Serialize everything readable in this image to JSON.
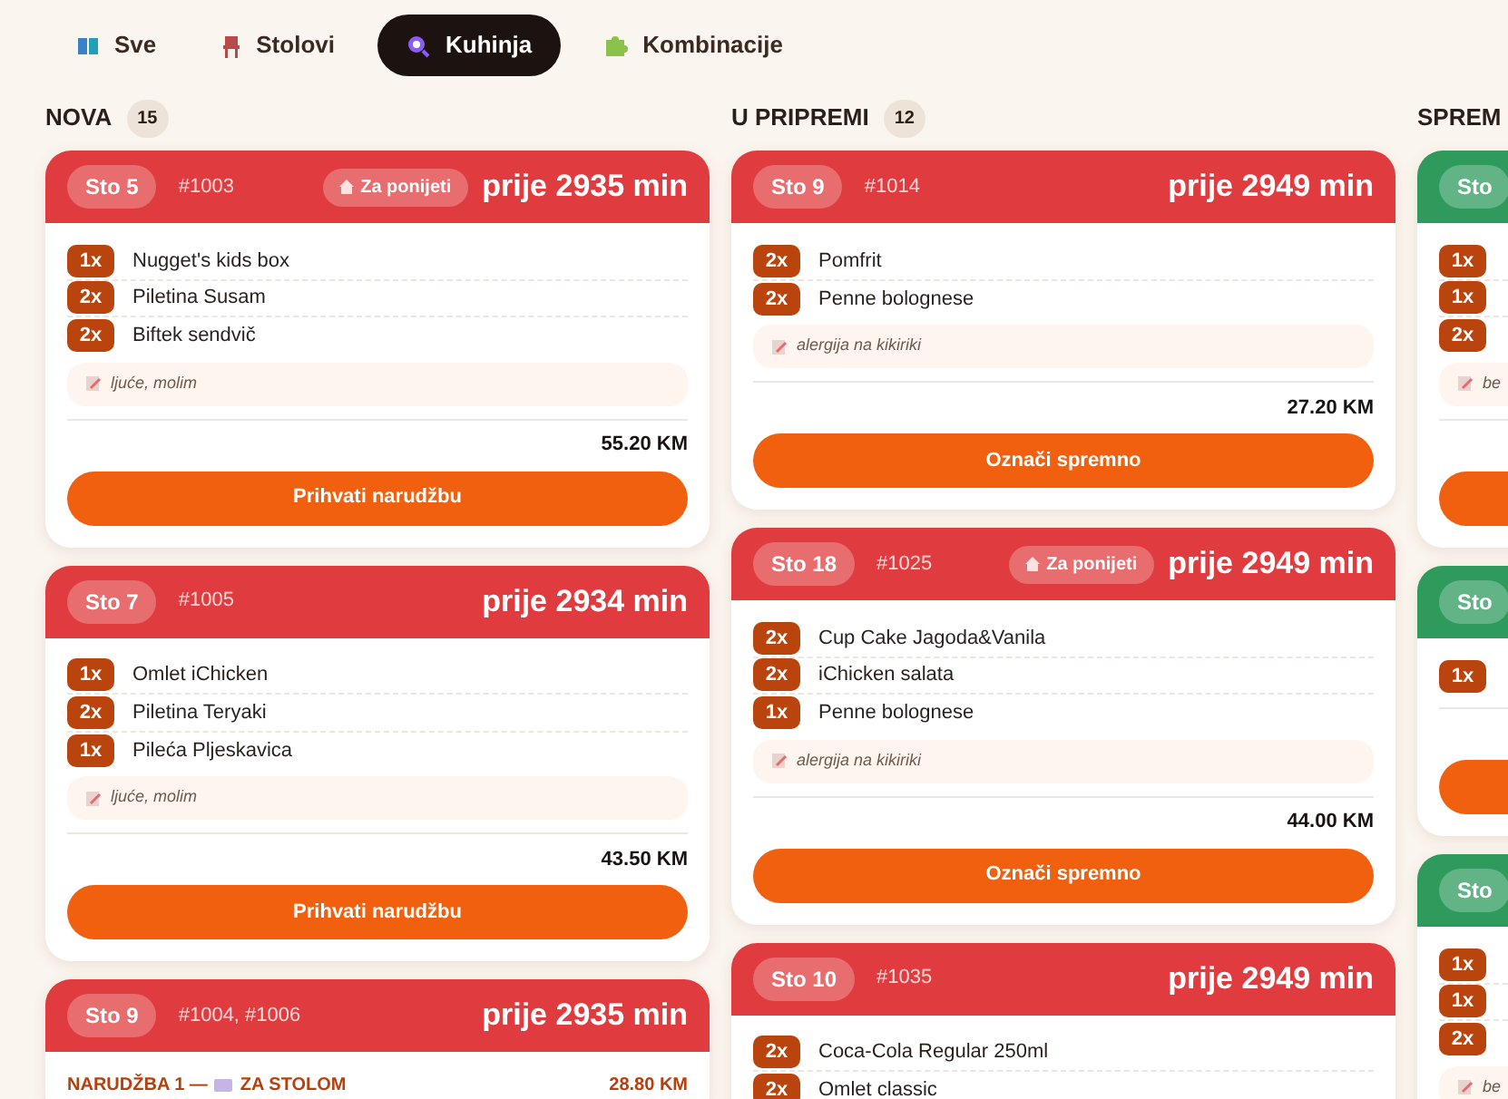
{
  "tabs": [
    {
      "label": "Sve",
      "selected": false
    },
    {
      "label": "Stolovi",
      "selected": false
    },
    {
      "label": "Kuhinja",
      "selected": true
    },
    {
      "label": "Kombinacije",
      "selected": false
    }
  ],
  "columns": [
    {
      "title": "NOVA",
      "count": "15",
      "kind": "new",
      "tickets": [
        {
          "table": "Sto 5",
          "ids": "#1003",
          "takeaway": "Za ponijeti",
          "time": "prije 2935 min",
          "items": [
            {
              "qty": "1x",
              "name": "Nugget's kids box"
            },
            {
              "qty": "2x",
              "name": "Piletina Susam"
            },
            {
              "qty": "2x",
              "name": "Biftek sendvič"
            }
          ],
          "note": "ljuće, molim",
          "total": "55.20 KM",
          "button": "Prihvati narudžbu"
        },
        {
          "table": "Sto 7",
          "ids": "#1005",
          "time": "prije 2934 min",
          "items": [
            {
              "qty": "1x",
              "name": "Omlet iChicken"
            },
            {
              "qty": "2x",
              "name": "Piletina Teryaki"
            },
            {
              "qty": "1x",
              "name": "Pileća Pljeskavica"
            }
          ],
          "note": "ljuće, molim",
          "total": "43.50 KM",
          "button": "Prihvati narudžbu"
        },
        {
          "table": "Sto 9",
          "ids": "#1004, #1006",
          "time": "prije 2935 min",
          "orders": [
            {
              "label": "NARUDŽBA 1 —",
              "type": "ZA STOLOM",
              "total": "28.80 KM"
            }
          ]
        }
      ]
    },
    {
      "title": "U PRIPREMI",
      "count": "12",
      "kind": "preparing",
      "tickets": [
        {
          "table": "Sto 9",
          "ids": "#1014",
          "time": "prije 2949 min",
          "items": [
            {
              "qty": "2x",
              "name": "Pomfrit"
            },
            {
              "qty": "2x",
              "name": "Penne bolognese"
            }
          ],
          "note": "alergija na kikiriki",
          "total": "27.20 KM",
          "button": "Označi spremno"
        },
        {
          "table": "Sto 18",
          "ids": "#1025",
          "takeaway": "Za ponijeti",
          "time": "prije 2949 min",
          "items": [
            {
              "qty": "2x",
              "name": "Cup Cake Jagoda&Vanila"
            },
            {
              "qty": "2x",
              "name": "iChicken salata"
            },
            {
              "qty": "1x",
              "name": "Penne bolognese"
            }
          ],
          "note": "alergija na kikiriki",
          "total": "44.00 KM",
          "button": "Označi spremno"
        },
        {
          "table": "Sto 10",
          "ids": "#1035",
          "time": "prije 2949 min",
          "items": [
            {
              "qty": "2x",
              "name": "Coca-Cola Regular 250ml"
            },
            {
              "qty": "2x",
              "name": "Omlet classic"
            }
          ]
        }
      ]
    },
    {
      "title": "SPREM",
      "kind": "ready",
      "tickets": [
        {
          "table": "Sto",
          "items": [
            {
              "qty": "1x"
            },
            {
              "qty": "1x"
            },
            {
              "qty": "2x"
            }
          ],
          "note": "be",
          "button_shown": true
        },
        {
          "table": "Sto",
          "items": [
            {
              "qty": "1x"
            }
          ],
          "button_shown": true
        },
        {
          "table": "Sto",
          "items": [
            {
              "qty": "1x"
            },
            {
              "qty": "1x"
            },
            {
              "qty": "2x"
            }
          ],
          "note": "be"
        }
      ]
    }
  ]
}
